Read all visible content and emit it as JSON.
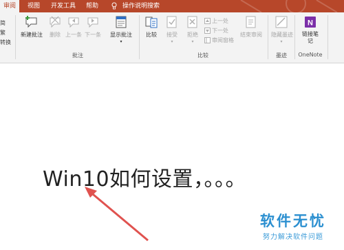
{
  "tabs": [
    {
      "label": "审阅",
      "active": true
    },
    {
      "label": "视图"
    },
    {
      "label": "开发工具"
    },
    {
      "label": "帮助"
    }
  ],
  "tell_me": "操作说明搜索",
  "left_partial": [
    "简",
    "繁",
    "转换"
  ],
  "ribbon": {
    "comments_group": "批注",
    "new_comment": "新建批注",
    "delete": "删除",
    "previous": "上一条",
    "next": "下一条",
    "show_comments": "显示批注",
    "compare_group": "比较",
    "compare": "比较",
    "accept": "接受",
    "reject": "拒绝",
    "prev_change": "上一处",
    "next_change": "下一处",
    "reviewing_pane": "审阅窗格",
    "end_review": "结束审阅",
    "ink_group": "墨迹",
    "hide_ink": "隐藏墨迹",
    "onenote_group": "OneNote",
    "linked_notes": "链接笔记"
  },
  "document": {
    "text": "Win10如何设置，。。。"
  },
  "watermark": {
    "main": "软件无忧",
    "sub": "努力解决软件问题"
  },
  "colors": {
    "tab_bar": "#b7472a",
    "ribbon_bg": "#f3f3f3",
    "annotation_arrow": "#e0524f",
    "watermark": "#2b8fd0"
  }
}
